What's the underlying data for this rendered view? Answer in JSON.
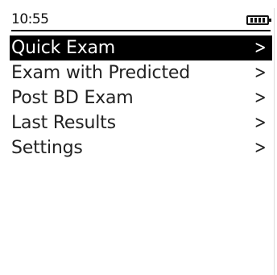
{
  "status": {
    "time": "10:55",
    "battery_icon": "battery-icon",
    "battery_cells": 4
  },
  "menu": {
    "items": [
      {
        "label": "Quick Exam",
        "selected": true,
        "icon": "chevron-right-icon"
      },
      {
        "label": "Exam with Predicted",
        "selected": false,
        "icon": "chevron-right-icon"
      },
      {
        "label": "Post BD Exam",
        "selected": false,
        "icon": "chevron-right-icon"
      },
      {
        "label": "Last Results",
        "selected": false,
        "icon": "chevron-right-icon"
      },
      {
        "label": "Settings",
        "selected": false,
        "icon": "chevron-right-icon"
      }
    ],
    "chevron_glyph": ">"
  },
  "colors": {
    "selection_background": "#000000",
    "selection_text": "#ffffff",
    "text": "#222222",
    "background": "#ffffff"
  }
}
